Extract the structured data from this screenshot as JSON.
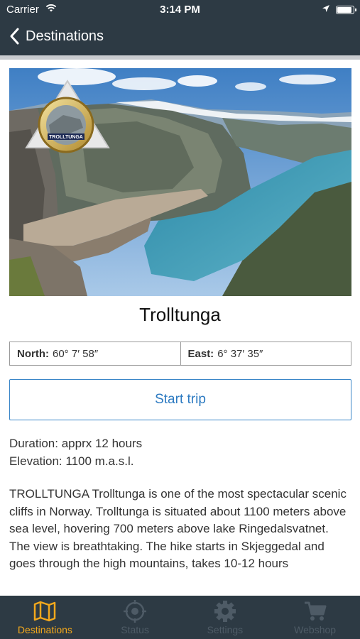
{
  "status_bar": {
    "carrier": "Carrier",
    "time": "3:14 PM"
  },
  "nav": {
    "back_label": "Destinations"
  },
  "destination": {
    "name": "Trolltunga",
    "north_label": "North:",
    "north_value": "60° 7′ 58″",
    "east_label": "East:",
    "east_value": "6° 37′ 35″",
    "start_button": "Start trip",
    "duration": "Duration: apprx 12 hours",
    "elevation": "Elevation: 1100 m.a.s.l.",
    "description": "TROLLTUNGA Trolltunga is one of the most spectacular scenic cliffs in Norway. Trolltunga is situated about 1100 meters above sea level, hovering 700 meters above lake Ringedalsvatnet. The view is breathtaking. The hike starts in Skjeggedal and goes through the high mountains, takes 10-12 hours",
    "badge_text": "TROLLTUNGA"
  },
  "tabs": [
    {
      "label": "Destinations",
      "icon": "map-icon",
      "active": true
    },
    {
      "label": "Status",
      "icon": "crosshair-icon",
      "active": false
    },
    {
      "label": "Settings",
      "icon": "gear-icon",
      "active": false
    },
    {
      "label": "Webshop",
      "icon": "cart-icon",
      "active": false
    }
  ],
  "colors": {
    "bar_background": "#2d3a44",
    "accent": "#f3a81c",
    "link_blue": "#2c7ac1"
  }
}
